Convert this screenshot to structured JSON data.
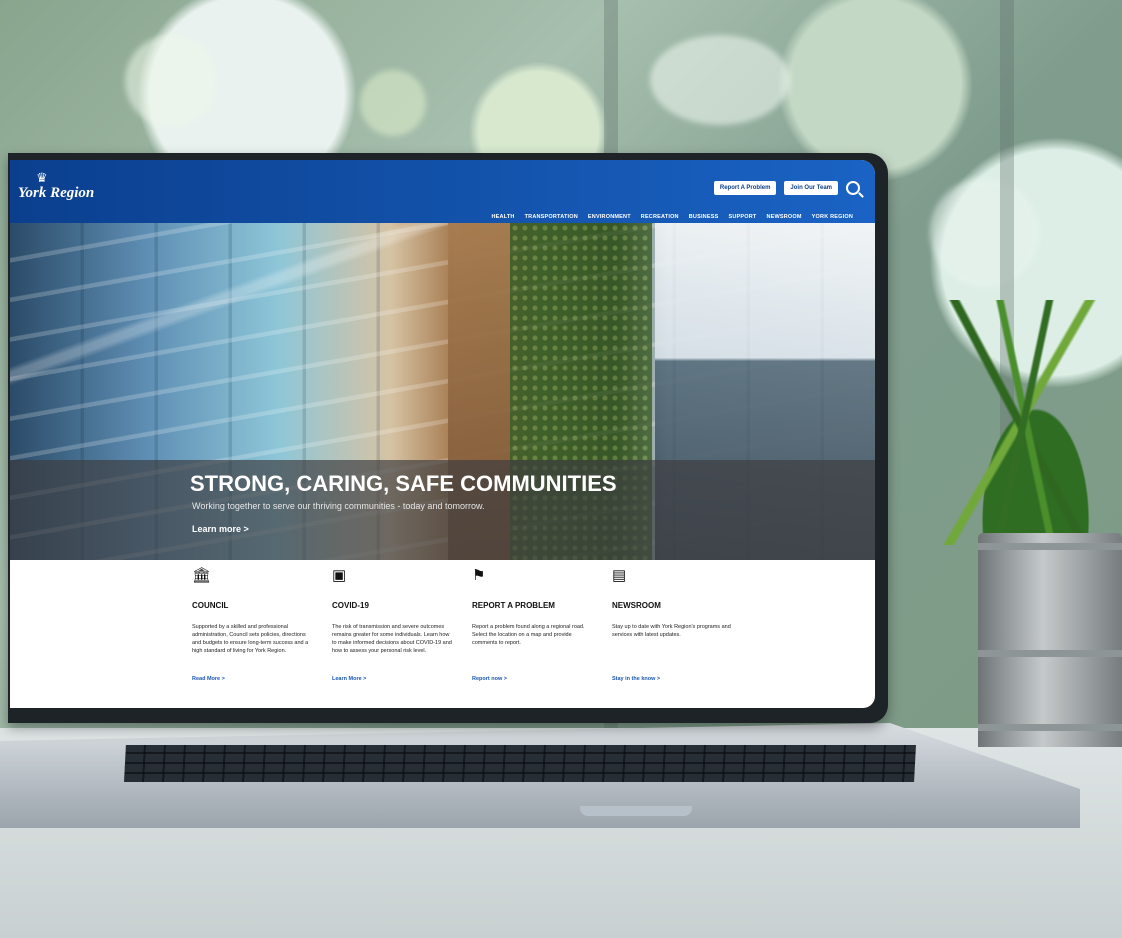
{
  "scene": {
    "background_colors": [
      "#89a58e",
      "#a7bfae",
      "#7f9c8d"
    ],
    "desk_color": "#d7ddde"
  },
  "site": {
    "logo": "York Region",
    "top_buttons": [
      "Report A Problem",
      "Join Our Team"
    ],
    "nav": [
      "HEALTH",
      "TRANSPORTATION",
      "ENVIRONMENT",
      "RECREATION",
      "BUSINESS",
      "SUPPORT",
      "NEWSROOM",
      "YORK REGION"
    ],
    "hero": {
      "title": "STRONG, CARING, SAFE COMMUNITIES",
      "subtitle": "Working together to serve our thriving communities - today and tomorrow.",
      "link": "Learn more >"
    },
    "cards": [
      {
        "icon": "government-building-icon",
        "title": "COUNCIL",
        "text": "Supported by a skilled and professional administration, Council sets policies, directions and budgets to ensure long-term success and a high standard of living for York Region.",
        "link": "Read More >"
      },
      {
        "icon": "laptop-medical-icon",
        "title": "COVID-19",
        "text": "The risk of transmission and severe outcomes remains greater for some individuals. Learn how to make informed decisions about COVID-19 and how to assess your personal risk level.",
        "link": "Learn More >"
      },
      {
        "icon": "flag-icon",
        "title": "REPORT A PROBLEM",
        "text": "Report a problem found along a regional road. Select the location on a map and provide comments to report.",
        "link": "Report now >"
      },
      {
        "icon": "newspaper-icon",
        "title": "NEWSROOM",
        "text": "Stay up to date with York Region's programs and services with latest updates.",
        "link": "Stay in the know >"
      }
    ]
  }
}
